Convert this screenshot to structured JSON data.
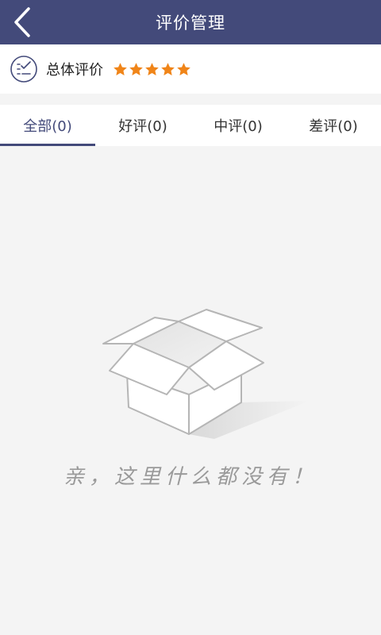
{
  "header": {
    "title": "评价管理",
    "back_icon": "chevron-left-icon"
  },
  "rating": {
    "label": "总体评价",
    "stars": 5,
    "star_color": "#f08519",
    "icon": "rating-list-icon"
  },
  "tabs": [
    {
      "label": "全部(0)",
      "active": true
    },
    {
      "label": "好评(0)",
      "active": false
    },
    {
      "label": "中评(0)",
      "active": false
    },
    {
      "label": "差评(0)",
      "active": false
    }
  ],
  "empty": {
    "message": "亲，这里什么都没有！",
    "icon": "empty-box-icon"
  },
  "colors": {
    "header_bg": "#434a7a",
    "page_bg": "#f4f4f4",
    "accent": "#434a7a"
  }
}
